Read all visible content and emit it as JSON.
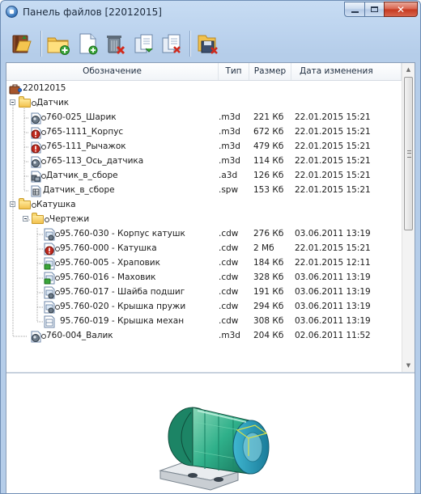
{
  "window": {
    "title": "Панель файлов [22012015]",
    "close_glyph": "✕"
  },
  "toolbar": {
    "icons": [
      "open-folder-book-icon",
      "add-folder-icon",
      "new-document-icon",
      "delete-trash-icon",
      "copy-documents-icon",
      "remove-documents-icon",
      "disk-delete-icon"
    ]
  },
  "columns": {
    "name": "Обозначение",
    "type": "Тип",
    "size": "Размер",
    "date": "Дата изменения"
  },
  "tree": {
    "root": "22012015",
    "folder1": "Датчик",
    "f1": {
      "name": "760-025_Шарик",
      "type": ".m3d",
      "size": "221 Кб",
      "date": "22.01.2015 15:21"
    },
    "f2": {
      "name": "765-1111_Корпус",
      "type": ".m3d",
      "size": "672 Кб",
      "date": "22.01.2015 15:21"
    },
    "f3": {
      "name": "765-111_Рычажок",
      "type": ".m3d",
      "size": "479 Кб",
      "date": "22.01.2015 15:21"
    },
    "f4": {
      "name": "765-113_Ось_датчика",
      "type": ".m3d",
      "size": "114 Кб",
      "date": "22.01.2015 15:21"
    },
    "f5": {
      "name": "Датчик_в_сборе",
      "type": ".a3d",
      "size": "126 Кб",
      "date": "22.01.2015 15:21"
    },
    "f6": {
      "name": "Датчик_в_сборе",
      "type": ".spw",
      "size": "153 Кб",
      "date": "22.01.2015 15:21"
    },
    "folder2": "Катушка",
    "folder3": "Чертежи",
    "d1": {
      "name": "95.760-030 - Корпус катушк",
      "type": ".cdw",
      "size": "276 Кб",
      "date": "03.06.2011 13:19"
    },
    "d2": {
      "name": "95.760-000 - Катушка",
      "type": ".cdw",
      "size": "2 Мб",
      "date": "22.01.2015 15:21"
    },
    "d3": {
      "name": "95.760-005 - Храповик",
      "type": ".cdw",
      "size": "184 Кб",
      "date": "22.01.2015 12:11"
    },
    "d4": {
      "name": "95.760-016 - Маховик",
      "type": ".cdw",
      "size": "328 Кб",
      "date": "03.06.2011 13:19"
    },
    "d5": {
      "name": "95.760-017 - Шайба подшиг",
      "type": ".cdw",
      "size": "191 Кб",
      "date": "03.06.2011 13:19"
    },
    "d6": {
      "name": "95.760-020 - Крышка пружи",
      "type": ".cdw",
      "size": "294 Кб",
      "date": "03.06.2011 13:19"
    },
    "d7": {
      "name": "95.760-019 - Крышка механ",
      "type": ".cdw",
      "size": "308 Кб",
      "date": "03.06.2011 13:19"
    },
    "f7": {
      "name": "760-004_Валик",
      "type": ".m3d",
      "size": "204 Кб",
      "date": "02.06.2011 11:52"
    }
  },
  "colors": {
    "accent_blue": "#2f6fb6",
    "folder_yellow": "#f2c24e",
    "error_red": "#c0281d",
    "model_green": "#2fb08a"
  }
}
